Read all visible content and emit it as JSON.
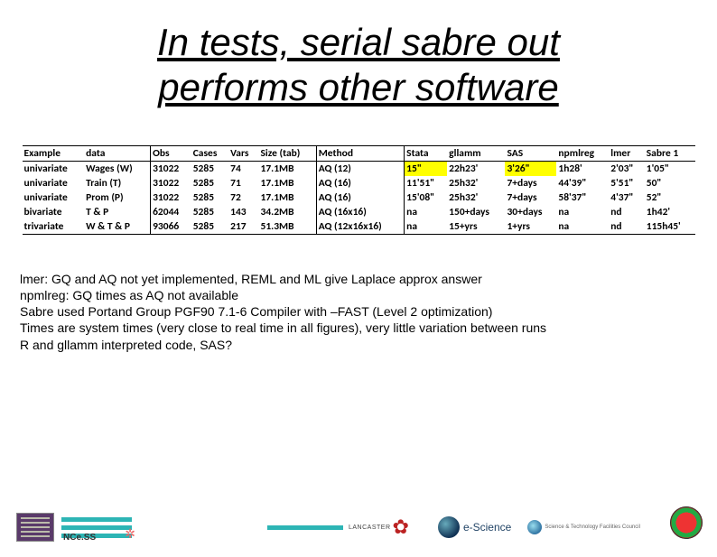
{
  "title_line1": "In tests, serial sabre out",
  "title_line2": "performs other software",
  "headers": {
    "c0": "Example",
    "c1": "data",
    "c2": "Obs",
    "c3": "Cases",
    "c4": "Vars",
    "c5": "Size (tab)",
    "c6": "Method",
    "c7": "Stata",
    "c8": "gllamm",
    "c9": "SAS",
    "c10": "npmlreg",
    "c11": "lmer",
    "c12": "Sabre 1"
  },
  "rows": [
    {
      "c0": "univariate",
      "c1": "Wages (W)",
      "c2": "31022",
      "c3": "5285",
      "c4": "74",
      "c5": "17.1MB",
      "c6": "AQ (12)",
      "c7": "15\"",
      "c8": "22h23'",
      "c9": "3'26\"",
      "c10": "1h28'",
      "c11": "2'03\"",
      "c12": "1'05\""
    },
    {
      "c0": "univariate",
      "c1": "Train (T)",
      "c2": "31022",
      "c3": "5285",
      "c4": "71",
      "c5": "17.1MB",
      "c6": "AQ (16)",
      "c7": "11'51\"",
      "c8": "25h32'",
      "c9": "7+days",
      "c10": "44'39\"",
      "c11": "5'51\"",
      "c12": "50\""
    },
    {
      "c0": "univariate",
      "c1": "Prom (P)",
      "c2": "31022",
      "c3": "5285",
      "c4": "72",
      "c5": "17.1MB",
      "c6": "AQ (16)",
      "c7": "15'08\"",
      "c8": "25h32'",
      "c9": "7+days",
      "c10": "58'37\"",
      "c11": "4'37\"",
      "c12": "52\""
    },
    {
      "c0": "bivariate",
      "c1": "T & P",
      "c2": "62044",
      "c3": "5285",
      "c4": "143",
      "c5": "34.2MB",
      "c6": "AQ (16x16)",
      "c7": "na",
      "c8": "150+days",
      "c9": "30+days",
      "c10": "na",
      "c11": "nd",
      "c12": "1h42'"
    },
    {
      "c0": "trivariate",
      "c1": "W & T & P",
      "c2": "93066",
      "c3": "5285",
      "c4": "217",
      "c5": "51.3MB",
      "c6": "AQ (12x16x16)",
      "c7": "na",
      "c8": "15+yrs",
      "c9": "1+yrs",
      "c10": "na",
      "c11": "nd",
      "c12": "115h45'"
    }
  ],
  "notes": {
    "n0": "lmer: GQ and AQ not yet implemented, REML and ML give Laplace approx answer",
    "n1": "npmlreg: GQ times as AQ not available",
    "n2": "Sabre used Portand Group PGF90 7.1-6 Compiler with –FAST (Level 2 optimization)",
    "n3": "Times are system times (very close to real time in all figures), very little variation between runs",
    "n4": "R and gllamm interpreted code, SAS?"
  },
  "footer": {
    "ncess": "NCe.SS",
    "lancaster": "LANCASTER",
    "escience": "e-Science",
    "stfc": "Science & Technology Facilities Council"
  },
  "chart_data": {
    "type": "table",
    "title": "In tests, serial sabre out performs other software",
    "columns": [
      "Example",
      "data",
      "Obs",
      "Cases",
      "Vars",
      "Size (tab)",
      "Method",
      "Stata",
      "gllamm",
      "SAS",
      "npmlreg",
      "lmer",
      "Sabre 1"
    ],
    "rows": [
      [
        "univariate",
        "Wages (W)",
        31022,
        5285,
        74,
        "17.1MB",
        "AQ (12)",
        "15\"",
        "22h23'",
        "3'26\"",
        "1h28'",
        "2'03\"",
        "1'05\""
      ],
      [
        "univariate",
        "Train (T)",
        31022,
        5285,
        71,
        "17.1MB",
        "AQ (16)",
        "11'51\"",
        "25h32'",
        "7+days",
        "44'39\"",
        "5'51\"",
        "50\""
      ],
      [
        "univariate",
        "Prom (P)",
        31022,
        5285,
        72,
        "17.1MB",
        "AQ (16)",
        "15'08\"",
        "25h32'",
        "7+days",
        "58'37\"",
        "4'37\"",
        "52\""
      ],
      [
        "bivariate",
        "T & P",
        62044,
        5285,
        143,
        "34.2MB",
        "AQ (16x16)",
        "na",
        "150+days",
        "30+days",
        "na",
        "nd",
        "1h42'"
      ],
      [
        "trivariate",
        "W & T & P",
        93066,
        5285,
        217,
        "51.3MB",
        "AQ (12x16x16)",
        "na",
        "15+yrs",
        "1+yrs",
        "na",
        "nd",
        "115h45'"
      ]
    ],
    "highlights": [
      {
        "row": 0,
        "column": "Stata",
        "value": "15\""
      },
      {
        "row": 0,
        "column": "SAS",
        "value": "3'26\""
      }
    ]
  }
}
